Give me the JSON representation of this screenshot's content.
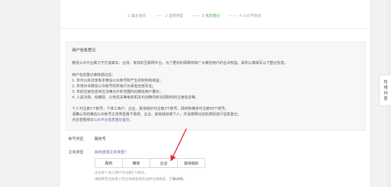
{
  "steps": [
    {
      "label": "1 基本信息",
      "active": false
    },
    {
      "label": "2 选择类型",
      "active": false
    },
    {
      "label": "3 信息登记",
      "active": true
    },
    {
      "label": "4 公众号信息",
      "active": false
    }
  ],
  "notice": {
    "title": "用户信息登记",
    "intro": "微信公众平台致力于打造真实、合法、有效的互联网平台。为了更好的保障你和广大微信用户的合法权益，请你认真填写以下登记信息。",
    "approved_header": "用户信息登记审核通过后：",
    "items": [
      "1. 你可以依法享有本微信公众帐号所产生的权利和收益；",
      "2. 你将对本微信公众帐号的所有行为承担全部责任；",
      "3. 你的注册信息将在法律允许的范围内向微信用户展示；",
      "4. 人民法院、检察院、公安机关等有权机关可向腾讯依法调取你的注册信息等。"
    ],
    "limit_line1": "个人可注册1个帐号，个体工商户、企业、其他组织可注册2个帐号，政府和媒体可注册50个帐号。",
    "limit_line2": "请确认你的微信公众帐号主体类型属于政府、企业、其他组织或个人，并请按照对应的类别进行信息登记。",
    "guide_prefix": "点击查看",
    "guide_link": "微信公众平台信息登记指引。"
  },
  "account_type": {
    "label": "帐号类型",
    "value": "服务号"
  },
  "subject_type": {
    "label": "主体类型",
    "help_link": "如何选择主体类型？",
    "options": [
      "政府",
      "媒体",
      "企业",
      "其他组织"
    ],
    "selected": "企业"
  },
  "tips": {
    "line1": "企业和个体工商户可注册2个帐号。",
    "line2_text": "请按照营业执照上的主体类型如实选择注册类型，",
    "line2_link": "了解详情。"
  },
  "side_tab": {
    "chars": [
      "在",
      "线",
      "问",
      "答"
    ]
  },
  "colors": {
    "accent": "#44b549",
    "link": "#576b95",
    "arrow": "#e8262b"
  }
}
